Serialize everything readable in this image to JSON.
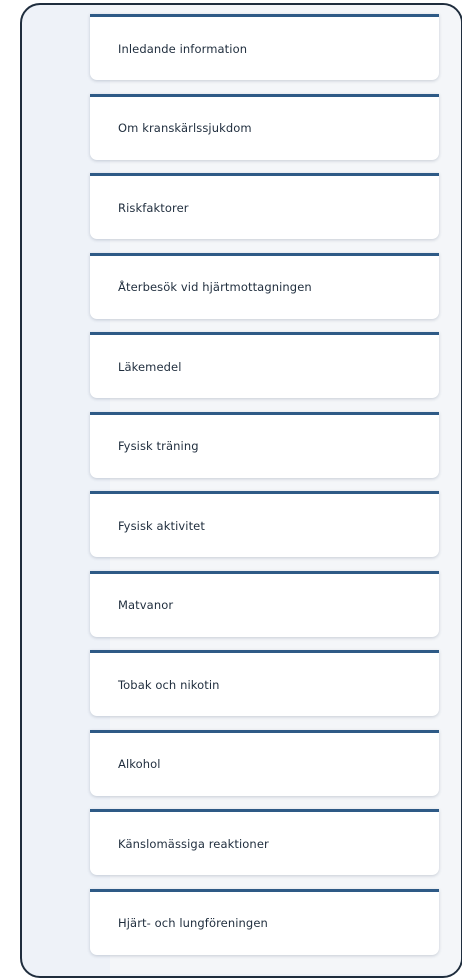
{
  "menu": {
    "items": [
      {
        "label": "Inledande information"
      },
      {
        "label": "Om kranskärlssjukdom"
      },
      {
        "label": "Riskfaktorer"
      },
      {
        "label": "Återbesök vid hjärtmottagningen"
      },
      {
        "label": "Läkemedel"
      },
      {
        "label": "Fysisk träning"
      },
      {
        "label": "Fysisk aktivitet"
      },
      {
        "label": "Matvanor"
      },
      {
        "label": "Tobak och nikotin"
      },
      {
        "label": "Alkohol"
      },
      {
        "label": "Känslomässiga reaktioner"
      },
      {
        "label": "Hjärt- och lungföreningen"
      }
    ]
  },
  "colors": {
    "accent_border": "#2e5a86",
    "text": "#1f2d3d",
    "frame_background": "#eef2f8"
  }
}
